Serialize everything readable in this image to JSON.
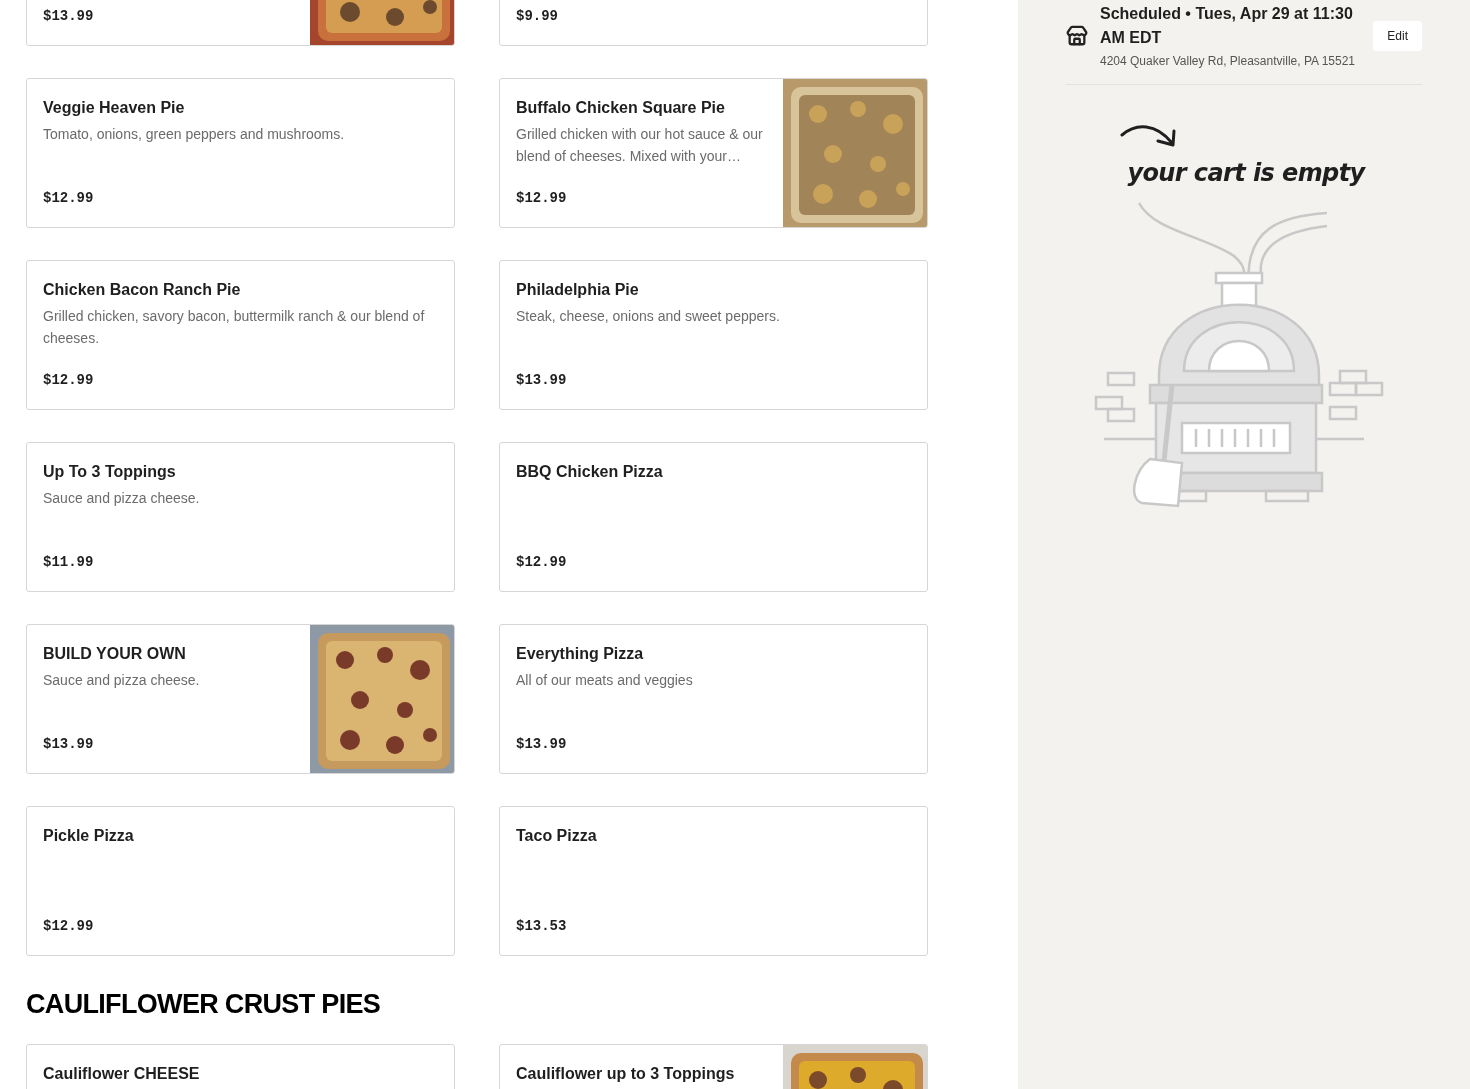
{
  "menu_sections": [
    {
      "items": [
        {
          "price": "$13.99"
        },
        {
          "price": "$9.99"
        },
        {
          "title": "Veggie Heaven Pie",
          "description": "Tomato, onions, green peppers and mushrooms.",
          "price": "$12.99"
        },
        {
          "title": "Buffalo Chicken Square Pie",
          "description": "Grilled chicken with our hot sauce & our blend of cheeses. Mixed with your…",
          "price": "$12.99"
        },
        {
          "title": "Chicken Bacon Ranch Pie",
          "description": "Grilled chicken, savory bacon, buttermilk ranch & our blend of cheeses.",
          "price": "$12.99"
        },
        {
          "title": "Philadelphia Pie",
          "description": "Steak, cheese, onions and sweet peppers.",
          "price": "$13.99"
        },
        {
          "title": "Up To 3 Toppings",
          "description": "Sauce and pizza cheese.",
          "price": "$11.99"
        },
        {
          "title": "BBQ Chicken Pizza",
          "price": "$12.99"
        },
        {
          "title": "BUILD YOUR OWN",
          "description": "Sauce and pizza cheese.",
          "price": "$13.99"
        },
        {
          "title": "Everything Pizza",
          "description": "All of our meats and veggies",
          "price": "$13.99"
        },
        {
          "title": "Pickle Pizza",
          "price": "$12.99"
        },
        {
          "title": "Taco Pizza",
          "price": "$13.53"
        }
      ]
    },
    {
      "heading": "CAULIFLOWER CRUST PIES",
      "items": [
        {
          "title": "Cauliflower CHEESE"
        },
        {
          "title": "Cauliflower up to 3 Toppings"
        }
      ]
    }
  ],
  "cart": {
    "schedule": "Scheduled • Tues, Apr 29 at 11:30 AM EDT",
    "address": "4204 Quaker Valley Rd, Pleasantville, PA 15521",
    "edit_button": "Edit",
    "empty_message": "your cart is empty"
  }
}
